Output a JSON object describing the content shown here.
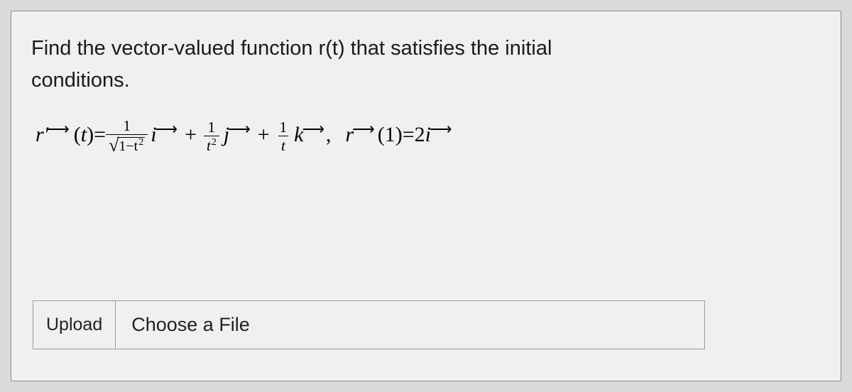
{
  "question": {
    "line1": "Find the vector-valued function r(t) that satisfies the initial",
    "line2": "conditions."
  },
  "equation": {
    "lhs_r": "r",
    "lhs_prime": "′",
    "lhs_t": "(t)",
    "equals": " = ",
    "frac1_num": "1",
    "frac1_den_inner": "1−t",
    "frac1_den_sup": "2",
    "i": "i",
    "plus": " + ",
    "frac2_num": "1",
    "frac2_den_base": "t",
    "frac2_den_sup": "2",
    "j": "j",
    "frac3_num": "1",
    "frac3_den": "t",
    "k": "k",
    "comma": ",",
    "rhs_r": "r",
    "rhs_t": "(1)",
    "rhs_equals": " = ",
    "rhs_val": "2",
    "rhs_i": "i"
  },
  "upload": {
    "label": "Upload",
    "button": "Choose a File"
  }
}
